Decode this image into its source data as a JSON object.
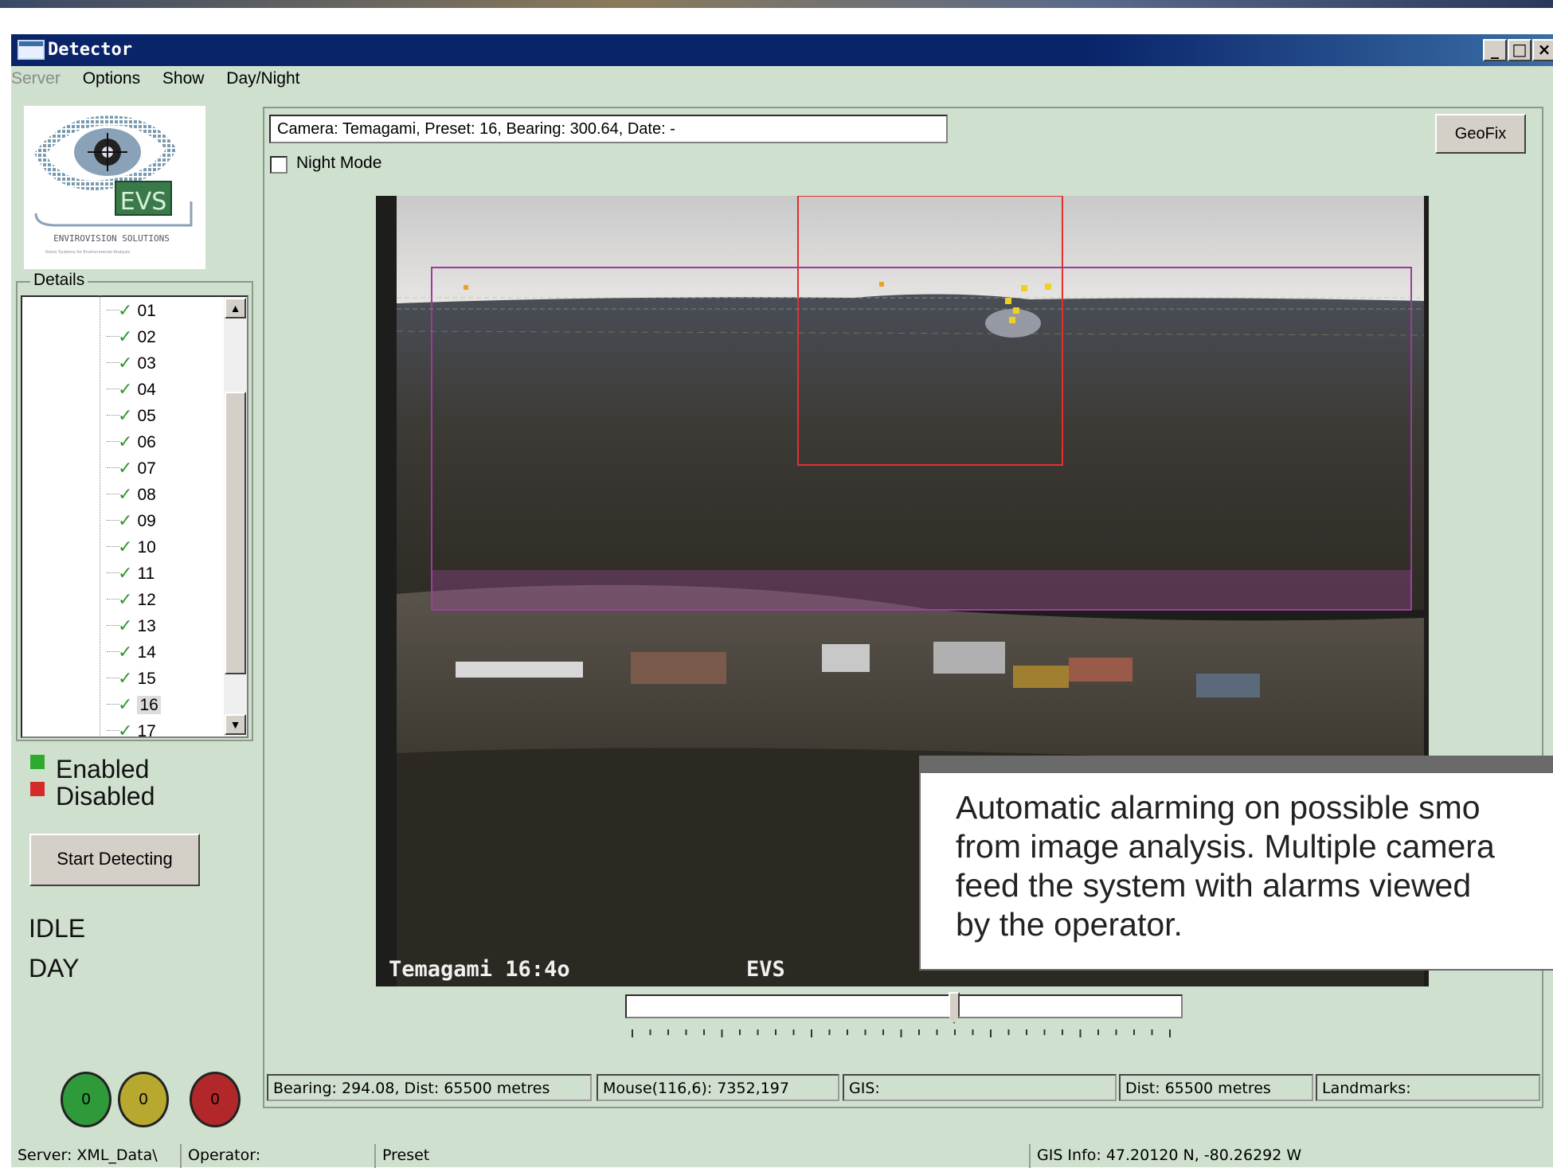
{
  "window": {
    "title": "Detector"
  },
  "menu": {
    "server": "Server",
    "options": "Options",
    "show": "Show",
    "daynight": "Day/Night"
  },
  "logo": {
    "brand": "EVS",
    "company": "ENVIROVISION SOLUTIONS",
    "tagline": "Vision Systems for Environmental Analysis"
  },
  "details": {
    "label": "Details",
    "items": [
      "01",
      "02",
      "03",
      "04",
      "05",
      "06",
      "07",
      "08",
      "09",
      "10",
      "11",
      "12",
      "13",
      "14",
      "15",
      "16",
      "17"
    ],
    "selected": "16"
  },
  "legend": {
    "enabled": "Enabled",
    "disabled": "Disabled",
    "enabled_color": "#2eaa2e",
    "disabled_color": "#d42a2a"
  },
  "controls": {
    "start_button": "Start Detecting",
    "state": "IDLE",
    "mode": "DAY"
  },
  "lamps": [
    {
      "value": "0",
      "color": "#2e9a3a"
    },
    {
      "value": "0",
      "color": "#b7a830"
    },
    {
      "value": "0",
      "color": "#b2282a"
    }
  ],
  "camera_info": "Camera: Temagami, Preset: 16, Bearing: 300.64, Date: -",
  "geofix_button": "GeoFix",
  "night_mode": {
    "label": "Night Mode",
    "checked": false
  },
  "video": {
    "overlay_left": "Temagami  16:4o",
    "overlay_right": "EVS"
  },
  "slider": {
    "value": 0.59
  },
  "status_fields": {
    "bearing": "Bearing: 294.08, Dist: 65500 metres",
    "mouse": "Mouse(116,6): 7352,197",
    "gis": "GIS:",
    "dist": "Dist: 65500 metres",
    "landmarks": "Landmarks:"
  },
  "bottom_status": {
    "server": "Server: XML_Data\\",
    "operator": "Operator:",
    "preset": "Preset",
    "gis_info": "GIS Info: 47.20120 N, -80.26292 W"
  },
  "callout": "Automatic alarming on possible smo\nfrom image analysis. Multiple camera\nfeed the system with alarms viewed\nby the operator."
}
